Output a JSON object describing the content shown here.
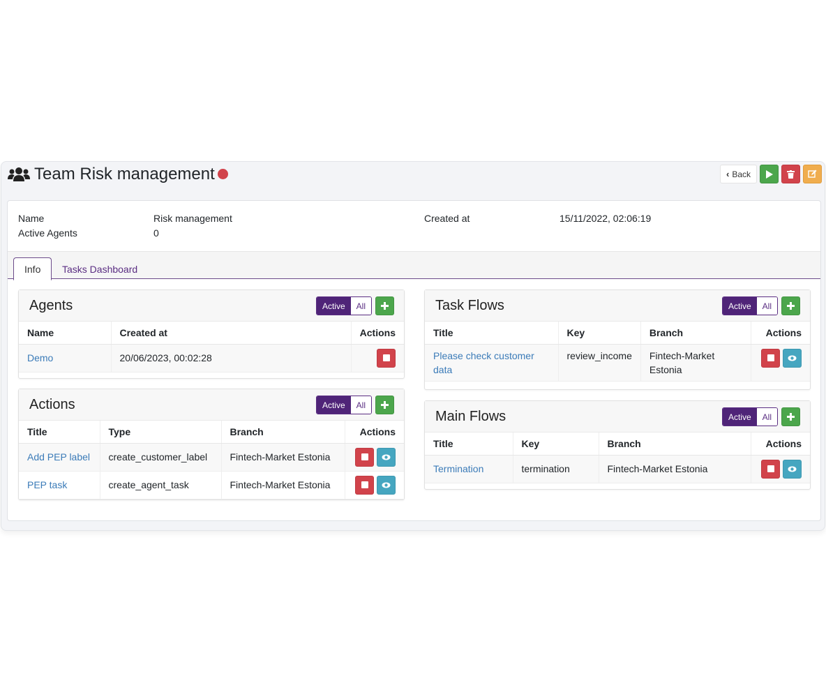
{
  "header": {
    "title": "Team Risk management",
    "status_color": "#d1434b",
    "back_label": "Back",
    "icons": [
      "team-icon",
      "play-icon",
      "trash-icon",
      "edit-icon"
    ]
  },
  "info": {
    "name_label": "Name",
    "name_value": "Risk management",
    "active_agents_label": "Active Agents",
    "active_agents_value": "0",
    "created_label": "Created at",
    "created_value": "15/11/2022, 02:06:19"
  },
  "tabs": [
    {
      "label": "Info",
      "active": true
    },
    {
      "label": "Tasks Dashboard",
      "active": false
    }
  ],
  "filter": {
    "active": "Active",
    "all": "All"
  },
  "agents": {
    "title": "Agents",
    "columns": [
      "Name",
      "Created at",
      "Actions"
    ],
    "rows": [
      {
        "name": "Demo",
        "created": "20/06/2023, 00:02:28"
      }
    ]
  },
  "actions_card": {
    "title": "Actions",
    "columns": [
      "Title",
      "Type",
      "Branch",
      "Actions"
    ],
    "rows": [
      {
        "title": "Add PEP label",
        "type": "create_customer_label",
        "branch": "Fintech-Market Estonia"
      },
      {
        "title": "PEP task",
        "type": "create_agent_task",
        "branch": "Fintech-Market Estonia"
      }
    ]
  },
  "task_flows": {
    "title": "Task Flows",
    "columns": [
      "Title",
      "Key",
      "Branch",
      "Actions"
    ],
    "rows": [
      {
        "title": "Please check customer data",
        "key": "review_income",
        "branch": "Fintech-Market Estonia"
      }
    ]
  },
  "main_flows": {
    "title": "Main Flows",
    "columns": [
      "Title",
      "Key",
      "Branch",
      "Actions"
    ],
    "rows": [
      {
        "title": "Termination",
        "key": "termination",
        "branch": "Fintech-Market Estonia"
      }
    ]
  },
  "colors": {
    "accent": "#4f2478",
    "success": "#4ca64c",
    "danger": "#d1434b",
    "warning": "#f0ad4e",
    "info": "#46a6c0",
    "link": "#3b7bb8"
  }
}
